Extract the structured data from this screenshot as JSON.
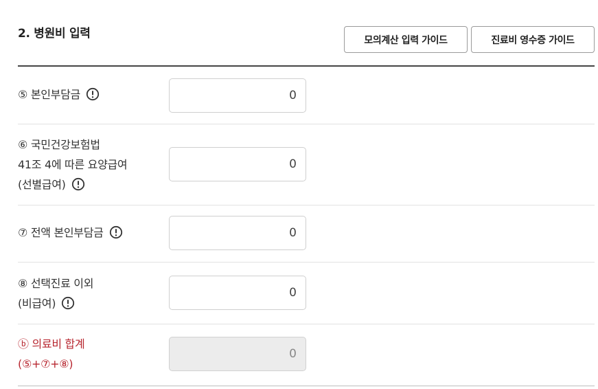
{
  "section": {
    "title": "2. 병원비 입력",
    "buttons": {
      "mock_calc_guide": "모의계산 입력 가이드",
      "receipt_guide": "진료비 영수증 가이드"
    }
  },
  "rows": [
    {
      "lines": [
        "⑤ 본인부담금"
      ],
      "value": "0",
      "readonly": false,
      "info_icon": "exclamation-circle-icon"
    },
    {
      "lines": [
        "⑥ 국민건강보험법",
        "41조 4에 따른 요양급여",
        "(선별급여)"
      ],
      "value": "0",
      "readonly": false,
      "info_icon": "exclamation-circle-icon"
    },
    {
      "lines": [
        "⑦ 전액 본인부담금"
      ],
      "value": "0",
      "readonly": false,
      "info_icon": "exclamation-circle-icon"
    },
    {
      "lines": [
        "⑧ 선택진료 이외",
        "(비급여)"
      ],
      "value": "0",
      "readonly": false,
      "info_icon": "exclamation-circle-icon"
    },
    {
      "lines": [
        "ⓑ 의료비 합계",
        "(⑤+⑦+⑧)"
      ],
      "value": "0",
      "readonly": true
    }
  ],
  "colors": {
    "total_label": "#b7262f",
    "readonly_field": "#ececec"
  }
}
